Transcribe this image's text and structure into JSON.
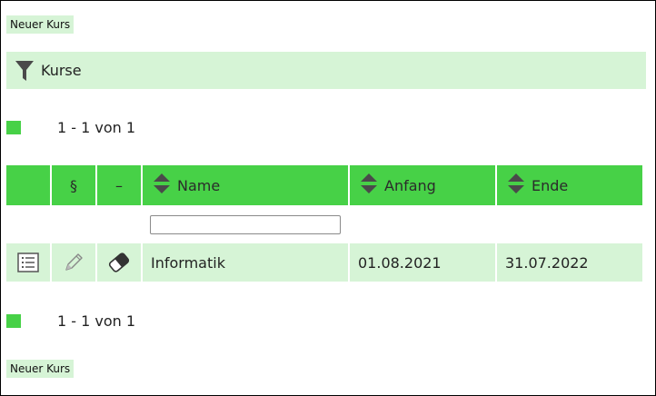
{
  "actions": {
    "new_course_label": "Neuer Kurs"
  },
  "filter_bar": {
    "title": "Kurse",
    "icon": "funnel-icon"
  },
  "pagination": {
    "range_text": "1 - 1 von 1"
  },
  "table": {
    "columns": {
      "col_paragraph": "§",
      "col_dash": "–",
      "name": "Name",
      "start": "Anfang",
      "end": "Ende"
    },
    "name_filter": {
      "value": "",
      "placeholder": ""
    },
    "rows": [
      {
        "name": "Informatik",
        "start": "01.08.2021",
        "end": "31.07.2022",
        "icons": [
          "list-detail-icon",
          "pencil-icon",
          "eraser-icon"
        ]
      }
    ]
  },
  "colors": {
    "header_green": "#47d147",
    "light_green": "#d6f4d6"
  }
}
